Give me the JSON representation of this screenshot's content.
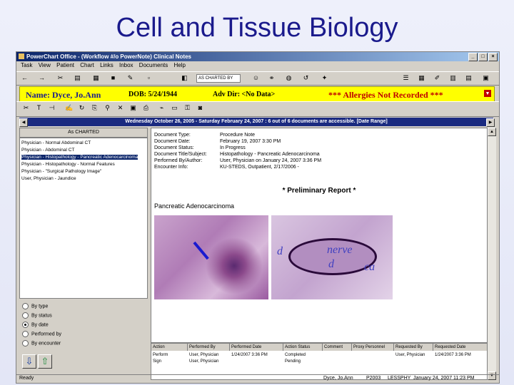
{
  "slide": {
    "title": "Cell and Tissue Biology"
  },
  "window": {
    "title": "PowerChart Office - (Workflow #/o PowerNote) Clinical Notes"
  },
  "menu": [
    "Task",
    "View",
    "Patient",
    "Chart",
    "Links",
    "Inbox",
    "Documents",
    "Help"
  ],
  "toolbar": {
    "combo_value": "AS CHARTED BY"
  },
  "banner": {
    "name": "Name: Dyce, Jo.Ann",
    "dob": "DOB: 5/24/1944",
    "adv_dir": "Adv Dir: <No Data>",
    "allergies": "*** Allergies Not Recorded ***"
  },
  "datebar": {
    "text": "Wednesday October 26, 2005 - Saturday February 24, 2007 : 6 out of 6 documents are accessible. [Date Range]"
  },
  "left": {
    "header": "As CHARTED",
    "docs": [
      "Physician - Normal Abdominal CT",
      "Physician - Abdominal CT",
      "Physician - Histopathology - Pancreatic Adenocarcinoma",
      "Physician - Histopathology - Normal Features",
      "Physician - \"Surgical Pathology Image\"",
      "User, Physician - Jaundice"
    ],
    "selected": 2,
    "sort_options": [
      "By type",
      "By status",
      "By date",
      "Performed by",
      "By encounter"
    ],
    "sort_selected": 2,
    "nav_down": "⇩",
    "nav_up": "⇧"
  },
  "doc": {
    "fields": [
      {
        "label": "Document Type:",
        "value": "Procedure Note"
      },
      {
        "label": "Document Date:",
        "value": "February 19, 2007 3:30 PM"
      },
      {
        "label": "Document Status:",
        "value": "In Progress"
      },
      {
        "label": "Document Title/Subject:",
        "value": "Histopathology - Pancreatic Adenocarcinoma"
      },
      {
        "label": "Performed By/Author:",
        "value": "User, Physician on January 24, 2007 3:36 PM"
      },
      {
        "label": "Encounter Info:",
        "value": "KU-STEDS, Outpatient, 2/17/2006 -"
      }
    ],
    "preliminary": "* Preliminary Report *",
    "subject": "Pancreatic Adenocarcinoma",
    "image_labels": {
      "nerve": "nerve",
      "d1": "d",
      "d2": "d",
      "ca": "ca"
    }
  },
  "grid": {
    "headers": [
      "Action",
      "Performed By",
      "Performed Date",
      "Action Status",
      "Comment",
      "Proxy Personnel",
      "Requested By",
      "Requested Date"
    ],
    "rows": [
      [
        "Perform",
        "User, Physician",
        "1/24/2007 3:36 PM",
        "Completed",
        "",
        "",
        "User, Physician",
        "1/24/2007 3:36 PM"
      ],
      [
        "Sign",
        "User, Physician",
        "",
        "Pending",
        "",
        "",
        "",
        ""
      ]
    ]
  },
  "status": {
    "left": "Ready",
    "user": "Dyce, Jo.Ann",
    "code": "P2003",
    "site": "LESSPHY",
    "datetime": "January 24, 2007 11:23 PM"
  }
}
